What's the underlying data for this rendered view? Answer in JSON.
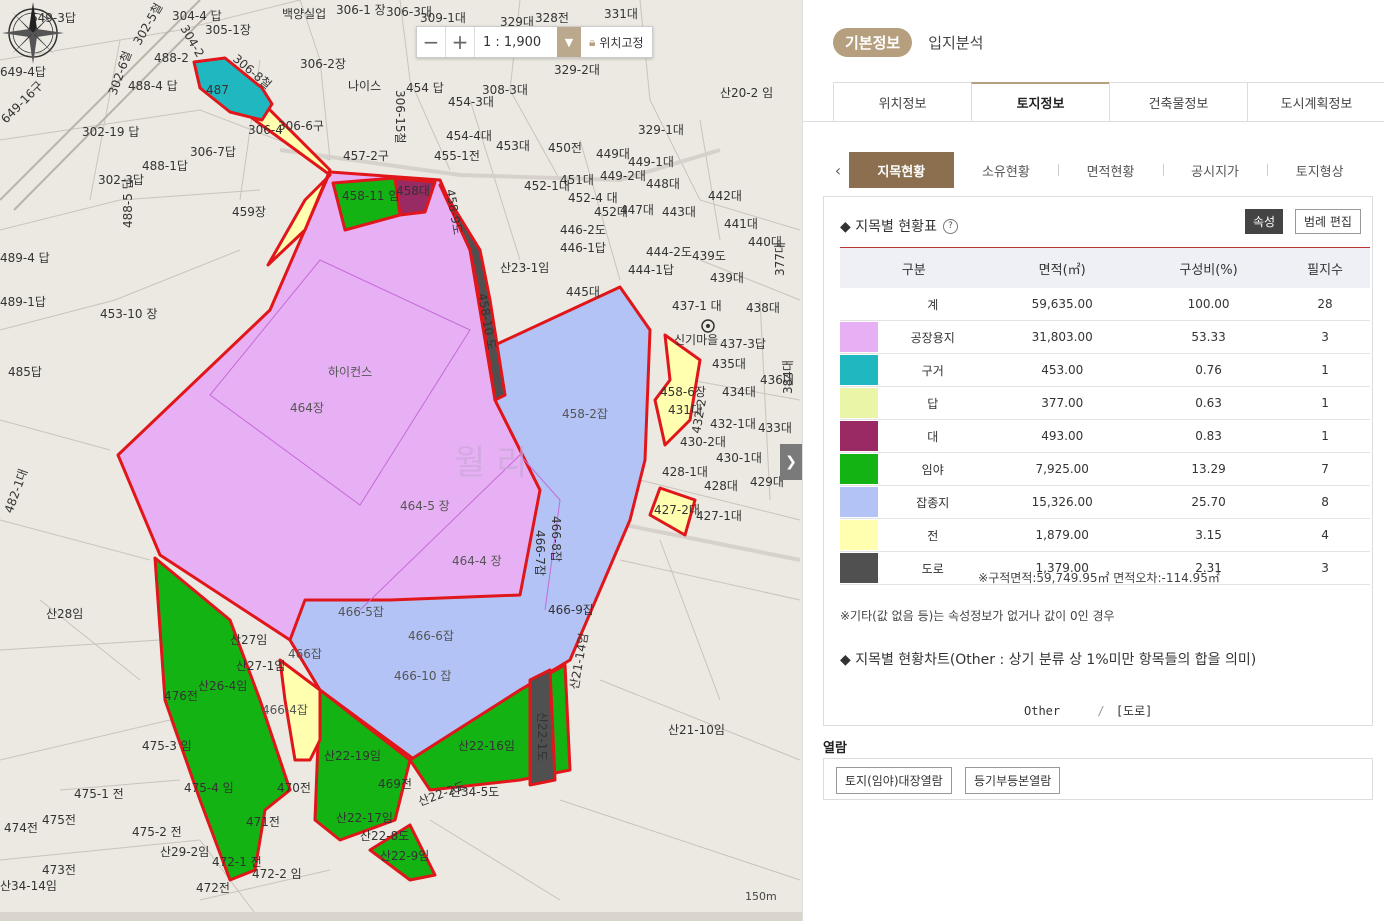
{
  "map": {
    "zoom_out": "−",
    "zoom_in": "+",
    "scale_value": "1 : 1,900",
    "scale_dropdown_icon": "chevron-down-icon",
    "lock_label": "위치고정",
    "compass_label": "산20-2 임",
    "watermark_village": "월 리",
    "scale_bar": "150m",
    "village_name": "신기마을",
    "lots": {
      "l1": "649-3답",
      "l2": "304-4 답",
      "l3": "305-1장",
      "l4": "백양실업",
      "l5": "306-1 장",
      "l6": "306-3대",
      "l7": "309-1대",
      "l8": "329대",
      "l9": "328전",
      "l10": "331대",
      "l11": "649-4답",
      "l12": "488-2",
      "l13": "306-2장",
      "l14": "나이스",
      "l15": "454 답",
      "l16": "308-3대",
      "l17": "329-2대",
      "l18": "488-4 답",
      "l19": "306-6구",
      "l20": "454-3대",
      "l21": "302-19 답",
      "l22": "306-7답",
      "l23": "454-4대",
      "l24": "453대",
      "l25": "450전",
      "l26": "449대",
      "l27": "449-1대",
      "l28": "329-1대",
      "l29": "488-1답",
      "l30": "457-2구",
      "l31": "455-1전",
      "l32": "451대",
      "l33": "449-2대",
      "l34": "448대",
      "l35": "302-3답",
      "l36": "458-11 임",
      "l37": "458대",
      "l38": "452-1대",
      "l39": "452-4 대",
      "l40": "442대",
      "l41": "459장",
      "l42": "452대",
      "l43": "447대",
      "l44": "443대",
      "l45": "441대",
      "l46": "446-2도",
      "l47": "440대",
      "l48": "446-1답",
      "l49": "489-4 답",
      "l50": "444-2도",
      "l51": "439도",
      "l52": "산23-1임",
      "l53": "444-1답",
      "l54": "439대",
      "l55": "489-1답",
      "l56": "445대",
      "l57": "437-1 대",
      "l58": "438대",
      "l59": "453-10 장",
      "l60": "437-3답",
      "l61": "435대",
      "l62": "485답",
      "l63": "하이컨스",
      "l64": "436대",
      "l65": "434대",
      "l66": "458-6장",
      "l67": "464장",
      "l68": "431대",
      "l69": "458-2잡",
      "l70": "432-1대",
      "l71": "433대",
      "l72": "430-2대",
      "l73": "430-1대",
      "l74": "428-1대",
      "l75": "429대",
      "l76": "428대",
      "l77": "464-5 장",
      "l78": "427-2대",
      "l79": "427-1대",
      "l80": "464-4 장",
      "l81": "466-5잡",
      "l82": "466-9잡",
      "l83": "산28임",
      "l84": "466-6잡",
      "l85": "산27임",
      "l86": "466잡",
      "l87": "산27-1임",
      "l88": "466-10 잡",
      "l89": "산26-4임",
      "l90": "476전",
      "l91": "466-4잡",
      "l92": "산21-10임",
      "l93": "산22-16임",
      "l94": "475-3 임",
      "l95": "산22-19임",
      "l96": "469전",
      "l97": "470전",
      "l98": "475-4 임",
      "l99": "산34-5도",
      "l100": "475-1 전",
      "l101": "471전",
      "l102": "산22-17임",
      "l103": "474전",
      "l104": "475전",
      "l105": "475-2 전",
      "l106": "산22-8도",
      "l107": "산29-2임",
      "l108": "산22-9임",
      "l109": "472-1 전",
      "l110": "473전",
      "l111": "472-2 임",
      "l112": "산34-14임",
      "l113": "472전",
      "l114": "482-1대",
      "l115": "302-5철",
      "l116": "302-6철",
      "l117": "304-2",
      "l118": "306-8철",
      "l119": "306-15철",
      "l120": "458-9도",
      "l121": "458-10 도",
      "l122": "466-7잡",
      "l123": "466-8잡",
      "l124": "산22-1도",
      "l125": "산21-14임",
      "l126": "산22-2도",
      "l127": "377대",
      "l128": "384대",
      "l129": "649-16구",
      "l130": "488-5 답",
      "l131": "487",
      "l132": "306-4",
      "l133": "432-2",
      "l134": "4",
      "l135": "3"
    }
  },
  "panel": {
    "pill_tab": "기본정보",
    "second_tab": "입지분석",
    "tabs": [
      "위치정보",
      "토지정보",
      "건축물정보",
      "도시계획정보"
    ],
    "subtabs": [
      "지목현황",
      "소유현황",
      "면적현황",
      "공시지가",
      "토지형상"
    ],
    "prev_icon": "chevron-left-icon",
    "section_title": "◆ 지목별 현황표",
    "help_icon": "question-icon",
    "help_glyph": "?",
    "attr_button": "속성",
    "legend_button": "범례 편집",
    "table": {
      "headers": [
        "구분",
        "면적(㎡)",
        "구성비(%)",
        "필지수"
      ],
      "rows": [
        {
          "color": "",
          "name": "계",
          "area": "59,635.00",
          "ratio": "100.00",
          "count": "28"
        },
        {
          "color": "#e8b0f4",
          "name": "공장용지",
          "area": "31,803.00",
          "ratio": "53.33",
          "count": "3"
        },
        {
          "color": "#1fb8c0",
          "name": "구거",
          "area": "453.00",
          "ratio": "0.76",
          "count": "1"
        },
        {
          "color": "#eaf5a8",
          "name": "답",
          "area": "377.00",
          "ratio": "0.63",
          "count": "1"
        },
        {
          "color": "#9a2a64",
          "name": "대",
          "area": "493.00",
          "ratio": "0.83",
          "count": "1"
        },
        {
          "color": "#12b312",
          "name": "임야",
          "area": "7,925.00",
          "ratio": "13.29",
          "count": "7"
        },
        {
          "color": "#b3c3f5",
          "name": "잡종지",
          "area": "15,326.00",
          "ratio": "25.70",
          "count": "8"
        },
        {
          "color": "#ffffaf",
          "name": "전",
          "area": "1,879.00",
          "ratio": "3.15",
          "count": "4"
        },
        {
          "color": "#505050",
          "name": "도로",
          "area": "1,379.00",
          "ratio": "2.31",
          "count": "3"
        }
      ]
    },
    "note_area": "※구적면적:59,749.95㎡  면적오차:-114.95㎡",
    "note_other": "※기타(값 없음 등)는 속성정보가 없거나 값이 0인 경우",
    "chart_title": "◆ 지목별 현황차트(Other : 상기 분류 상 1%미만 항목들의 합을 의미)",
    "chart_labels": [
      "Other",
      "[도로]"
    ],
    "view_title": "열람",
    "view_buttons": [
      "토지(임야)대장열람",
      "등기부등본열람"
    ]
  }
}
